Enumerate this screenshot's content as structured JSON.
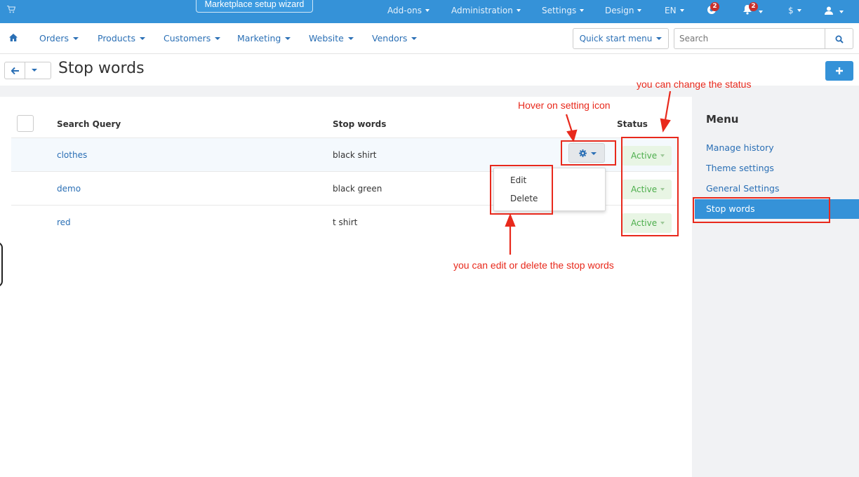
{
  "topbar": {
    "wizard": "Marketplace setup wizard",
    "menus": [
      "Add-ons",
      "Administration",
      "Settings",
      "Design",
      "EN"
    ],
    "help_badge": "2",
    "bell_badge": "2",
    "currency": "$"
  },
  "nav": {
    "items": [
      "Orders",
      "Products",
      "Customers",
      "Marketing",
      "Website",
      "Vendors"
    ],
    "quick_start": "Quick start menu",
    "search_placeholder": "Search"
  },
  "page": {
    "title": "Stop words"
  },
  "table": {
    "headers": [
      "Search Query",
      "Stop words",
      "Status"
    ],
    "rows": [
      {
        "query": "clothes",
        "words": "black shirt",
        "status": "Active"
      },
      {
        "query": "demo",
        "words": "black green",
        "status": "Active"
      },
      {
        "query": "red",
        "words": "t shirt",
        "status": "Active"
      }
    ]
  },
  "dropdown": {
    "items": [
      "Edit",
      "Delete"
    ]
  },
  "sidebar": {
    "title": "Menu",
    "items": [
      "Manage history",
      "Theme settings",
      "General Settings",
      "Stop words"
    ],
    "active_index": 3
  },
  "annotations": {
    "hover": "Hover on setting icon",
    "status": "you can change the status",
    "edit": "you can edit or delete the stop words"
  },
  "colors": {
    "accent": "#3592d8",
    "annotation": "#e8291c",
    "active_status": "#4cae4c"
  }
}
